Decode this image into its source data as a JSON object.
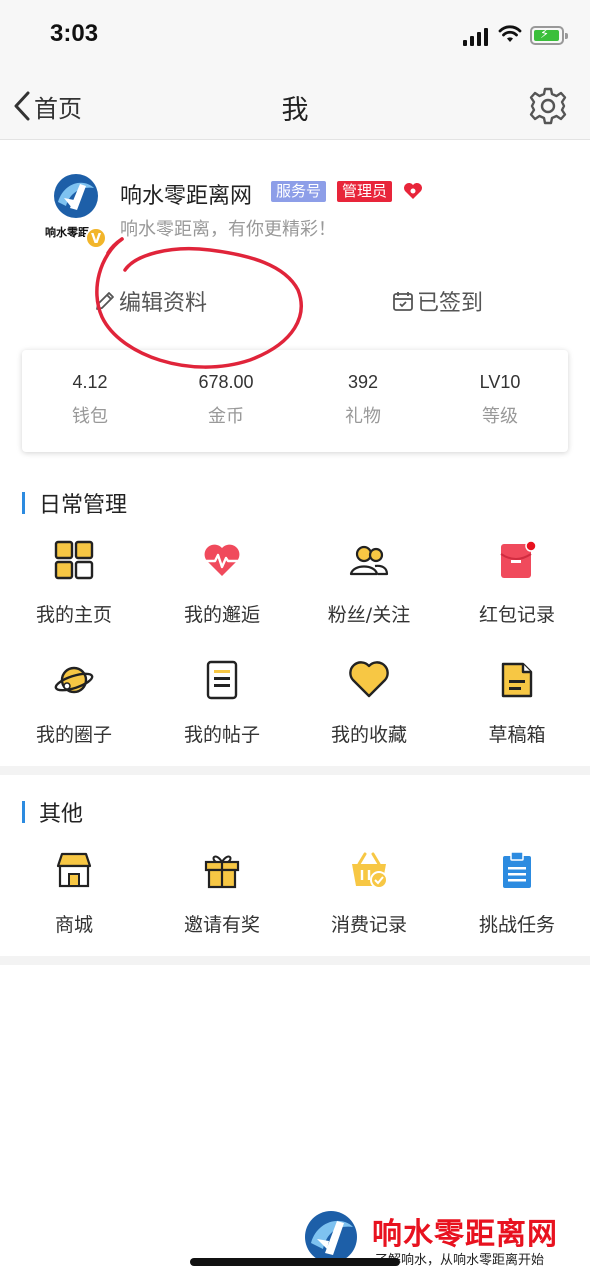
{
  "status_bar": {
    "time": "3:03"
  },
  "nav": {
    "back_label": "首页",
    "title": "我"
  },
  "profile": {
    "name": "响水零距离网",
    "badge_service": "服务号",
    "badge_admin": "管理员",
    "motto": "响水零距离，有你更精彩！",
    "avatar_text": "响水零距"
  },
  "actions": {
    "edit": "编辑资料",
    "signed": "已签到"
  },
  "stats": [
    {
      "value": "4.12",
      "label": "钱包"
    },
    {
      "value": "678.00",
      "label": "金币"
    },
    {
      "value": "392",
      "label": "礼物"
    },
    {
      "value": "LV10",
      "label": "等级"
    }
  ],
  "daily": {
    "title": "日常管理",
    "items": [
      {
        "label": "我的主页",
        "icon": "grid-home-icon"
      },
      {
        "label": "我的邂逅",
        "icon": "heartbeat-icon"
      },
      {
        "label": "粉丝/关注",
        "icon": "people-icon"
      },
      {
        "label": "红包记录",
        "icon": "red-envelope-icon"
      },
      {
        "label": "我的圈子",
        "icon": "planet-icon"
      },
      {
        "label": "我的帖子",
        "icon": "document-icon"
      },
      {
        "label": "我的收藏",
        "icon": "heart-icon"
      },
      {
        "label": "草稿箱",
        "icon": "draft-file-icon"
      }
    ]
  },
  "other": {
    "title": "其他",
    "items": [
      {
        "label": "商城",
        "icon": "shop-icon"
      },
      {
        "label": "邀请有奖",
        "icon": "gift-icon"
      },
      {
        "label": "消费记录",
        "icon": "basket-icon"
      },
      {
        "label": "挑战任务",
        "icon": "clipboard-icon"
      }
    ]
  },
  "watermark": {
    "title": "响水零距离网",
    "subtitle": "了解响水，从响水零距离开始"
  },
  "colors": {
    "accent_blue": "#2c8be0",
    "admin_red": "#e8253a",
    "service_purple": "#8d9ee8",
    "icon_yellow": "#f7c744"
  }
}
